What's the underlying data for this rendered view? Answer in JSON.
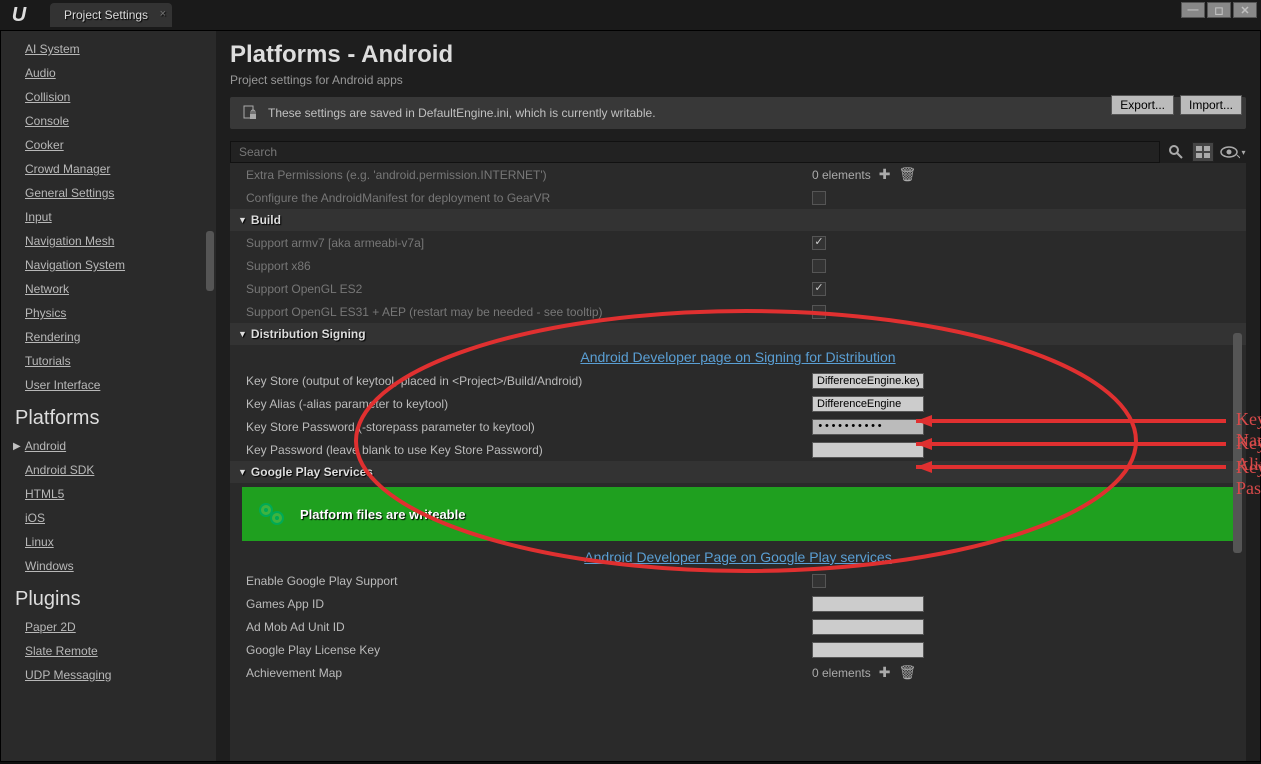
{
  "window": {
    "tab_title": "Project Settings"
  },
  "sidebar": {
    "engine_items": [
      "AI System",
      "Audio",
      "Collision",
      "Console",
      "Cooker",
      "Crowd Manager",
      "General Settings",
      "Input",
      "Navigation Mesh",
      "Navigation System",
      "Network",
      "Physics",
      "Rendering",
      "Tutorials",
      "User Interface"
    ],
    "platforms_header": "Platforms",
    "platforms_items": [
      "Android",
      "Android SDK",
      "HTML5",
      "iOS",
      "Linux",
      "Windows"
    ],
    "plugins_header": "Plugins",
    "plugins_items": [
      "Paper 2D",
      "Slate Remote",
      "UDP Messaging"
    ]
  },
  "header": {
    "title": "Platforms - Android",
    "subtitle": "Project settings for Android apps",
    "export": "Export...",
    "import": "Import..."
  },
  "infobar": {
    "text": "These settings are saved in DefaultEngine.ini, which is currently writable."
  },
  "search": {
    "placeholder": "Search"
  },
  "settings": {
    "extra_perm_label": "Extra Permissions (e.g. 'android.permission.INTERNET')",
    "elements_0": "0 elements",
    "gearvr_label": "Configure the AndroidManifest for deployment to GearVR",
    "build_header": "Build",
    "armv7_label": "Support armv7 [aka armeabi-v7a]",
    "x86_label": "Support x86",
    "es2_label": "Support OpenGL ES2",
    "es31_label": "Support OpenGL ES31 + AEP (restart may be needed - see tooltip)",
    "dist_header": "Distribution Signing",
    "dist_link": "Android Developer page on Signing for Distribution",
    "keystore_label": "Key Store (output of keytool, placed in <Project>/Build/Android)",
    "keystore_value": "DifferenceEngine.keystore",
    "keyalias_label": "Key Alias (-alias parameter to keytool)",
    "keyalias_value": "DifferenceEngine",
    "keystorepass_label": "Key Store Password (-storepass parameter to keytool)",
    "keystorepass_value": "••••••••••",
    "keypass_label": "Key Password (leave blank to use Key Store Password)",
    "keypass_value": "",
    "gps_header": "Google Play Services",
    "gps_banner": "Platform files are writeable",
    "gps_link": "Android Developer Page on Google Play services",
    "enable_gp_label": "Enable Google Play Support",
    "gamesappid_label": "Games App ID",
    "admob_label": "Ad Mob Ad Unit ID",
    "license_label": "Google Play License Key",
    "achmap_label": "Achievement Map"
  },
  "annotations": {
    "keystore_name": "Keystore Name",
    "keystore_alias": "Keystore Alias",
    "keystore_password": "Keystore Pasword"
  }
}
